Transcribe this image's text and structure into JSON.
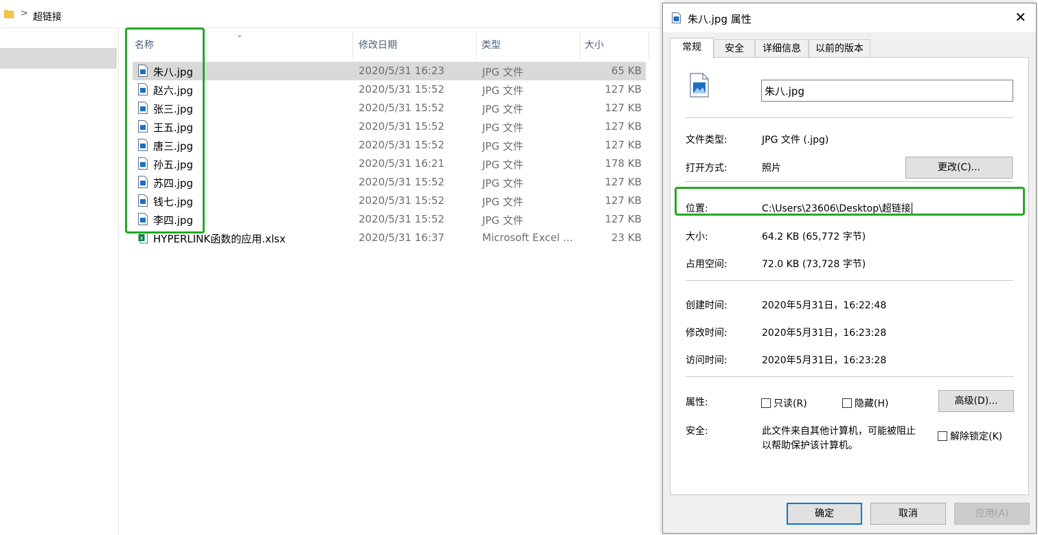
{
  "explorer": {
    "breadcrumb": ">",
    "folder_name": "超链接",
    "sort_indicator": "⌄",
    "columns": {
      "name": "名称",
      "date": "修改日期",
      "type": "类型",
      "size": "大小"
    },
    "files": [
      {
        "name": "朱八.jpg",
        "date": "2020/5/31 16:23",
        "type": "JPG 文件",
        "size": "65 KB",
        "icon": "image-file-icon"
      },
      {
        "name": "赵六.jpg",
        "date": "2020/5/31 15:52",
        "type": "JPG 文件",
        "size": "127 KB",
        "icon": "image-file-icon"
      },
      {
        "name": "张三.jpg",
        "date": "2020/5/31 15:52",
        "type": "JPG 文件",
        "size": "127 KB",
        "icon": "image-file-icon"
      },
      {
        "name": "王五.jpg",
        "date": "2020/5/31 15:52",
        "type": "JPG 文件",
        "size": "127 KB",
        "icon": "image-file-icon"
      },
      {
        "name": "唐三.jpg",
        "date": "2020/5/31 15:52",
        "type": "JPG 文件",
        "size": "127 KB",
        "icon": "image-file-icon"
      },
      {
        "name": "孙五.jpg",
        "date": "2020/5/31 16:21",
        "type": "JPG 文件",
        "size": "178 KB",
        "icon": "image-file-icon"
      },
      {
        "name": "苏四.jpg",
        "date": "2020/5/31 15:52",
        "type": "JPG 文件",
        "size": "127 KB",
        "icon": "image-file-icon"
      },
      {
        "name": "钱七.jpg",
        "date": "2020/5/31 15:52",
        "type": "JPG 文件",
        "size": "127 KB",
        "icon": "image-file-icon"
      },
      {
        "name": "李四.jpg",
        "date": "2020/5/31 15:52",
        "type": "JPG 文件",
        "size": "127 KB",
        "icon": "image-file-icon"
      },
      {
        "name": "HYPERLINK函数的应用.xlsx",
        "date": "2020/5/31 16:37",
        "type": "Microsoft Excel ...",
        "size": "23 KB",
        "icon": "excel-file-icon"
      }
    ]
  },
  "dialog": {
    "title": "朱八.jpg 属性",
    "close_glyph": "✕",
    "tabs": [
      "常规",
      "安全",
      "详细信息",
      "以前的版本"
    ],
    "file_name_value": "朱八.jpg",
    "rows": {
      "file_type_label": "文件类型:",
      "file_type_value": "JPG 文件 (.jpg)",
      "open_with_label": "打开方式:",
      "open_with_value": "照片",
      "change_button": "更改(C)...",
      "location_label": "位置:",
      "location_value": "C:\\Users\\23606\\Desktop\\超链接",
      "size_label": "大小:",
      "size_value": "64.2 KB (65,772 字节)",
      "disk_label": "占用空间:",
      "disk_value": "72.0 KB (73,728 字节)",
      "created_label": "创建时间:",
      "created_value": "2020年5月31日，16:22:48",
      "modified_label": "修改时间:",
      "modified_value": "2020年5月31日，16:23:28",
      "accessed_label": "访问时间:",
      "accessed_value": "2020年5月31日，16:23:28",
      "attributes_label": "属性:",
      "readonly_label": "只读(R)",
      "hidden_label": "隐藏(H)",
      "advanced_button": "高级(D)...",
      "security_label": "安全:",
      "security_text_1": "此文件来自其他计算机，可能被阻止",
      "security_text_2": "以帮助保护该计算机。",
      "unblock_label": "解除锁定(K)"
    },
    "buttons": {
      "ok": "确定",
      "cancel": "取消",
      "apply": "应用(A)"
    }
  },
  "colors": {
    "highlight": "#22a822",
    "selected_row": "#d9d9d9",
    "folder": "#f5c542"
  }
}
